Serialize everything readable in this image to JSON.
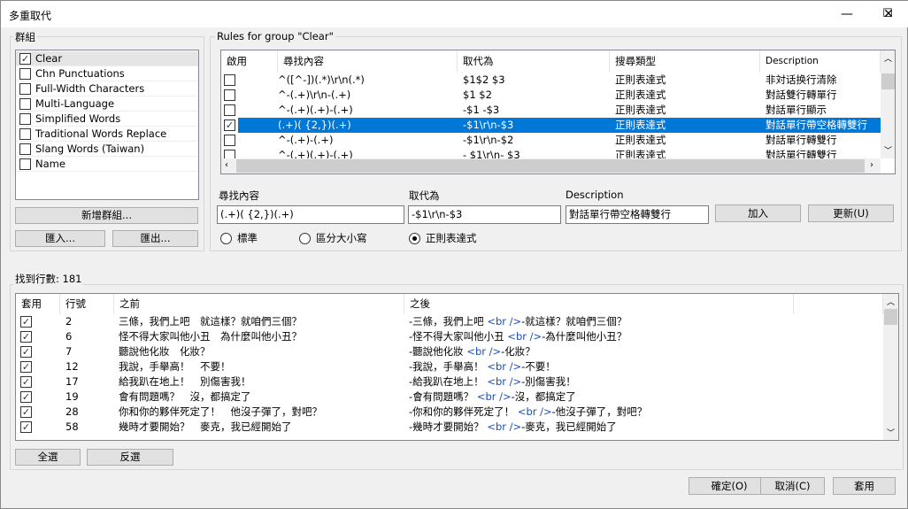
{
  "window": {
    "title": "多重取代",
    "minimize": "—",
    "maximize": "☐",
    "close": "✕"
  },
  "groups": {
    "label": "群組",
    "items": [
      {
        "label": "Clear",
        "checked": true,
        "selected": true
      },
      {
        "label": "Chn Punctuations",
        "checked": false
      },
      {
        "label": "Full-Width Characters",
        "checked": false
      },
      {
        "label": "Multi-Language",
        "checked": false
      },
      {
        "label": "Simplified Words",
        "checked": false
      },
      {
        "label": "Traditional Words Replace",
        "checked": false
      },
      {
        "label": "Slang Words (Taiwan)",
        "checked": false
      },
      {
        "label": "Name",
        "checked": false
      }
    ],
    "new_group": "新增群組...",
    "import": "匯入...",
    "export": "匯出..."
  },
  "rules": {
    "label": "Rules for group \"Clear\"",
    "columns": [
      "啟用",
      "尋找內容",
      "取代為",
      "搜尋類型",
      "Description"
    ],
    "rows": [
      {
        "enabled": false,
        "find": "^([^-])(.*)\\r\\n(.*)",
        "replace": "$1$2 $3",
        "type": "正則表達式",
        "desc": "非対话换行清除"
      },
      {
        "enabled": false,
        "find": "^-(.+)\\r\\n-(.+)",
        "replace": "$1   $2",
        "type": "正則表達式",
        "desc": "對話雙行轉單行"
      },
      {
        "enabled": false,
        "find": "^-(.+)(.+)-(.+)",
        "replace": "-$1   -$3",
        "type": "正則表達式",
        "desc": "對話單行顯示"
      },
      {
        "enabled": true,
        "find": "(.+)( {2,})(.+)",
        "replace": "-$1\\r\\n-$3",
        "type": "正則表達式",
        "desc": "對話單行帶空格轉雙行",
        "selected": true
      },
      {
        "enabled": false,
        "find": "^-(.+)-(.+)",
        "replace": "-$1\\r\\n-$2",
        "type": "正則表達式",
        "desc": "對話單行轉雙行"
      },
      {
        "enabled": false,
        "find": "^-(.+)(.+)-(.+)",
        "replace": "- $1\\r\\n- $3",
        "type": "正則表達式",
        "desc": "對話單行轉雙行"
      }
    ],
    "find_label": "尋找內容",
    "find_value": "(.+)( {2,})(.+)",
    "replace_label": "取代為",
    "replace_value": "-$1\\r\\n-$3",
    "desc_label": "Description",
    "desc_value": "對話單行帶空格轉雙行",
    "add": "加入",
    "update": "更新(U)",
    "modes": [
      {
        "label": "標準",
        "selected": false
      },
      {
        "label": "區分大小寫",
        "selected": false
      },
      {
        "label": "正則表達式",
        "selected": true
      }
    ]
  },
  "results": {
    "label": "找到行數: 181",
    "columns": [
      "套用",
      "行號",
      "之前",
      "之後"
    ],
    "rows": [
      {
        "apply": true,
        "line": "2",
        "before": "三條，我們上吧　就這樣？就咱們三個？",
        "after_a": "-三條，我們上吧 ",
        "after_br": "<br />",
        "after_b": "-就這樣？就咱們三個？"
      },
      {
        "apply": true,
        "line": "6",
        "before": "怪不得大家叫他小丑　為什麼叫他小丑？",
        "after_a": "-怪不得大家叫他小丑 ",
        "after_br": "<br />",
        "after_b": "-為什麼叫他小丑？"
      },
      {
        "apply": true,
        "line": "7",
        "before": "聽說他化妝　化妝？",
        "after_a": "-聽說他化妝 ",
        "after_br": "<br />",
        "after_b": "-化妝？"
      },
      {
        "apply": true,
        "line": "12",
        "before": "我說，手舉高！　不要！",
        "after_a": "-我說，手舉高！ ",
        "after_br": "<br />",
        "after_b": "-不要！"
      },
      {
        "apply": true,
        "line": "17",
        "before": "給我趴在地上！　別傷害我！",
        "after_a": "-給我趴在地上！ ",
        "after_br": "<br />",
        "after_b": "-別傷害我！"
      },
      {
        "apply": true,
        "line": "19",
        "before": "會有問題嗎？　沒，都搞定了",
        "after_a": "-會有問題嗎？ ",
        "after_br": "<br />",
        "after_b": "-沒，都搞定了"
      },
      {
        "apply": true,
        "line": "28",
        "before": "你和你的夥伴死定了！　他沒子彈了，對吧？",
        "after_a": "-你和你的夥伴死定了！ ",
        "after_br": "<br />",
        "after_b": "-他沒子彈了，對吧？"
      },
      {
        "apply": true,
        "line": "58",
        "before": "幾時才要開始？　麥克，我已經開始了",
        "after_a": "-幾時才要開始？ ",
        "after_br": "<br />",
        "after_b": "-麥克，我已經開始了"
      }
    ],
    "select_all": "全選",
    "invert": "反選"
  },
  "footer": {
    "ok": "確定(O)",
    "cancel": "取消(C)",
    "apply": "套用"
  }
}
